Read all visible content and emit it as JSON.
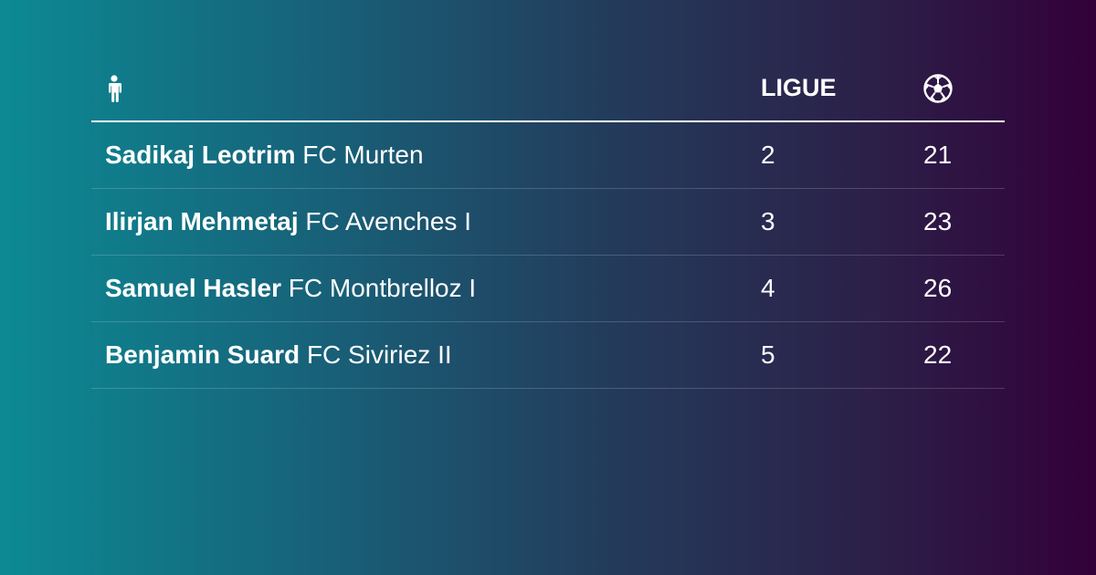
{
  "header": {
    "player_icon": "person-icon",
    "league_label": "LIGUE",
    "goals_icon": "soccer-ball-icon"
  },
  "rows": [
    {
      "player": "Sadikaj Leotrim",
      "club": "FC Murten",
      "league": "2",
      "goals": "21"
    },
    {
      "player": "Ilirjan Mehmetaj",
      "club": "FC Avenches I",
      "league": "3",
      "goals": "23"
    },
    {
      "player": "Samuel Hasler",
      "club": "FC Montbrelloz I",
      "league": "4",
      "goals": "26"
    },
    {
      "player": "Benjamin Suard",
      "club": "FC Siviriez II",
      "league": "5",
      "goals": "22"
    }
  ],
  "colors": {
    "gradient_start": "#0c8a94",
    "gradient_end": "#33003a",
    "text": "#ffffff"
  }
}
